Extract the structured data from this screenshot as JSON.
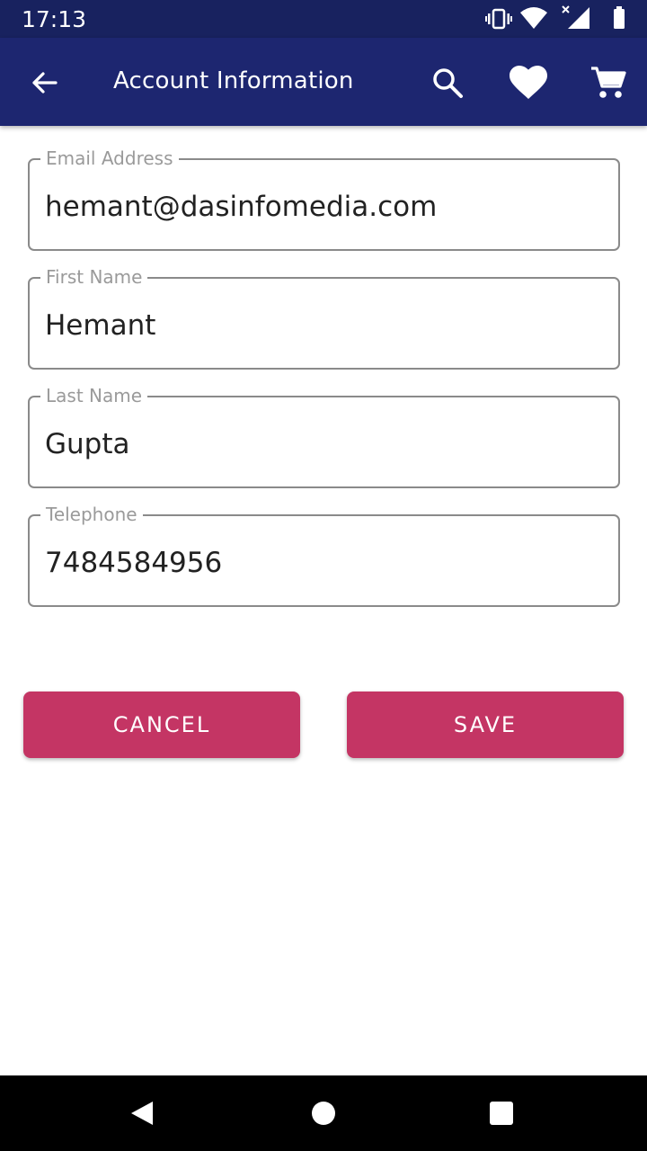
{
  "status_bar": {
    "time": "17:13",
    "icons": [
      "vibrate-icon",
      "wifi-icon",
      "cellular-signal-icon",
      "battery-icon"
    ]
  },
  "app_bar": {
    "title": "Account Information",
    "icons": [
      "back-arrow-icon",
      "search-icon",
      "heart-icon",
      "cart-icon"
    ],
    "color": "#1d2670"
  },
  "form": {
    "fields": [
      {
        "label": "Email Address",
        "value": "hemant@dasinfomedia.com"
      },
      {
        "label": "First Name",
        "value": "Hemant"
      },
      {
        "label": "Last Name",
        "value": "Gupta"
      },
      {
        "label": "Telephone",
        "value": "7484584956"
      }
    ]
  },
  "actions": {
    "cancel_label": "CANCEL",
    "save_label": "SAVE",
    "button_color": "#c43564"
  },
  "nav_bar": {
    "icons": [
      "nav-back-icon",
      "nav-home-icon",
      "nav-recents-icon"
    ]
  }
}
